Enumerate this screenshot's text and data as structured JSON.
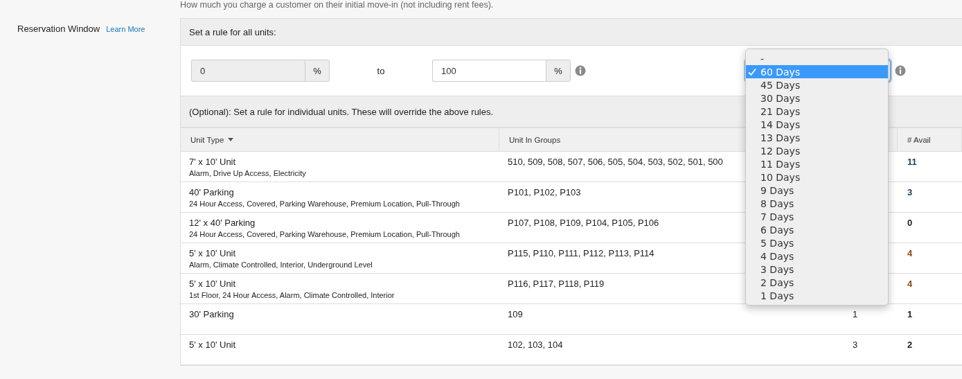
{
  "intro_text": "How much you charge a customer on their initial move-in (not including rent fees).",
  "setting": {
    "label": "Reservation Window",
    "link": "Learn More"
  },
  "rule_all": {
    "heading": "Set a rule for all units:",
    "min_field": {
      "value": "0",
      "unit": "%",
      "disabled": true
    },
    "separator": "to",
    "max_field": {
      "value": "100",
      "unit": "%",
      "disabled": false
    },
    "window_select": {
      "expanded": true,
      "options": [
        {
          "label": "-",
          "selected": false
        },
        {
          "label": "60 Days",
          "selected": true
        },
        {
          "label": "45 Days",
          "selected": false
        },
        {
          "label": "30 Days",
          "selected": false
        },
        {
          "label": "21 Days",
          "selected": false
        },
        {
          "label": "14 Days",
          "selected": false
        },
        {
          "label": "13 Days",
          "selected": false
        },
        {
          "label": "12 Days",
          "selected": false
        },
        {
          "label": "11 Days",
          "selected": false
        },
        {
          "label": "10 Days",
          "selected": false
        },
        {
          "label": "9 Days",
          "selected": false
        },
        {
          "label": "8 Days",
          "selected": false
        },
        {
          "label": "7 Days",
          "selected": false
        },
        {
          "label": "6 Days",
          "selected": false
        },
        {
          "label": "5 Days",
          "selected": false
        },
        {
          "label": "4 Days",
          "selected": false
        },
        {
          "label": "3 Days",
          "selected": false
        },
        {
          "label": "2 Days",
          "selected": false
        },
        {
          "label": "1 Days",
          "selected": false
        }
      ]
    }
  },
  "rule_individual": {
    "heading": "(Optional): Set a rule for individual units. These will override the above rules."
  },
  "table": {
    "columns": [
      {
        "label": "Unit Type",
        "sortable": true
      },
      {
        "label": "Unit In Groups",
        "sortable": false
      },
      {
        "label": "# Avail",
        "sortable": false
      }
    ],
    "rows": [
      {
        "unit_type": "7' x 10' Unit",
        "features": "Alarm, Drive Up Access, Electricity",
        "groups": "510, 509, 508, 507, 506, 505, 504, 503, 502, 501, 500",
        "avail": "11",
        "color": "#1f3a56"
      },
      {
        "unit_type": "40' Parking",
        "features": "24 Hour Access, Covered, Parking Warehouse, Premium Location, Pull-Through",
        "groups": "P101, P102, P103",
        "avail": "3",
        "color": "#1f3a56"
      },
      {
        "unit_type": "12' x 40' Parking",
        "features": "24 Hour Access, Covered, Parking Warehouse, Premium Location, Pull-Through",
        "groups": "P107, P108, P109, P104, P105, P106",
        "avail": "0",
        "color": "#222222"
      },
      {
        "unit_type": "5' x 10' Unit",
        "features": "Alarm, Climate Controlled, Interior, Underground Level",
        "groups": "P115, P110, P111, P112, P113, P114",
        "avail": "4",
        "color": "#8a4a0c"
      },
      {
        "unit_type": "5' x 10' Unit",
        "features": "1st Floor, 24 Hour Access, Alarm, Climate Controlled, Interior",
        "groups": "P116, P117, P118, P119",
        "avail": "4",
        "color": "#8a4a0c"
      },
      {
        "unit_type": "30' Parking",
        "groups": "109",
        "column_3": "1",
        "avail": "1",
        "color": "#222222"
      },
      {
        "unit_type": "5' x 10' Unit",
        "groups": "102, 103, 104",
        "column_3": "3",
        "avail": "2",
        "color": "#222222"
      }
    ]
  }
}
